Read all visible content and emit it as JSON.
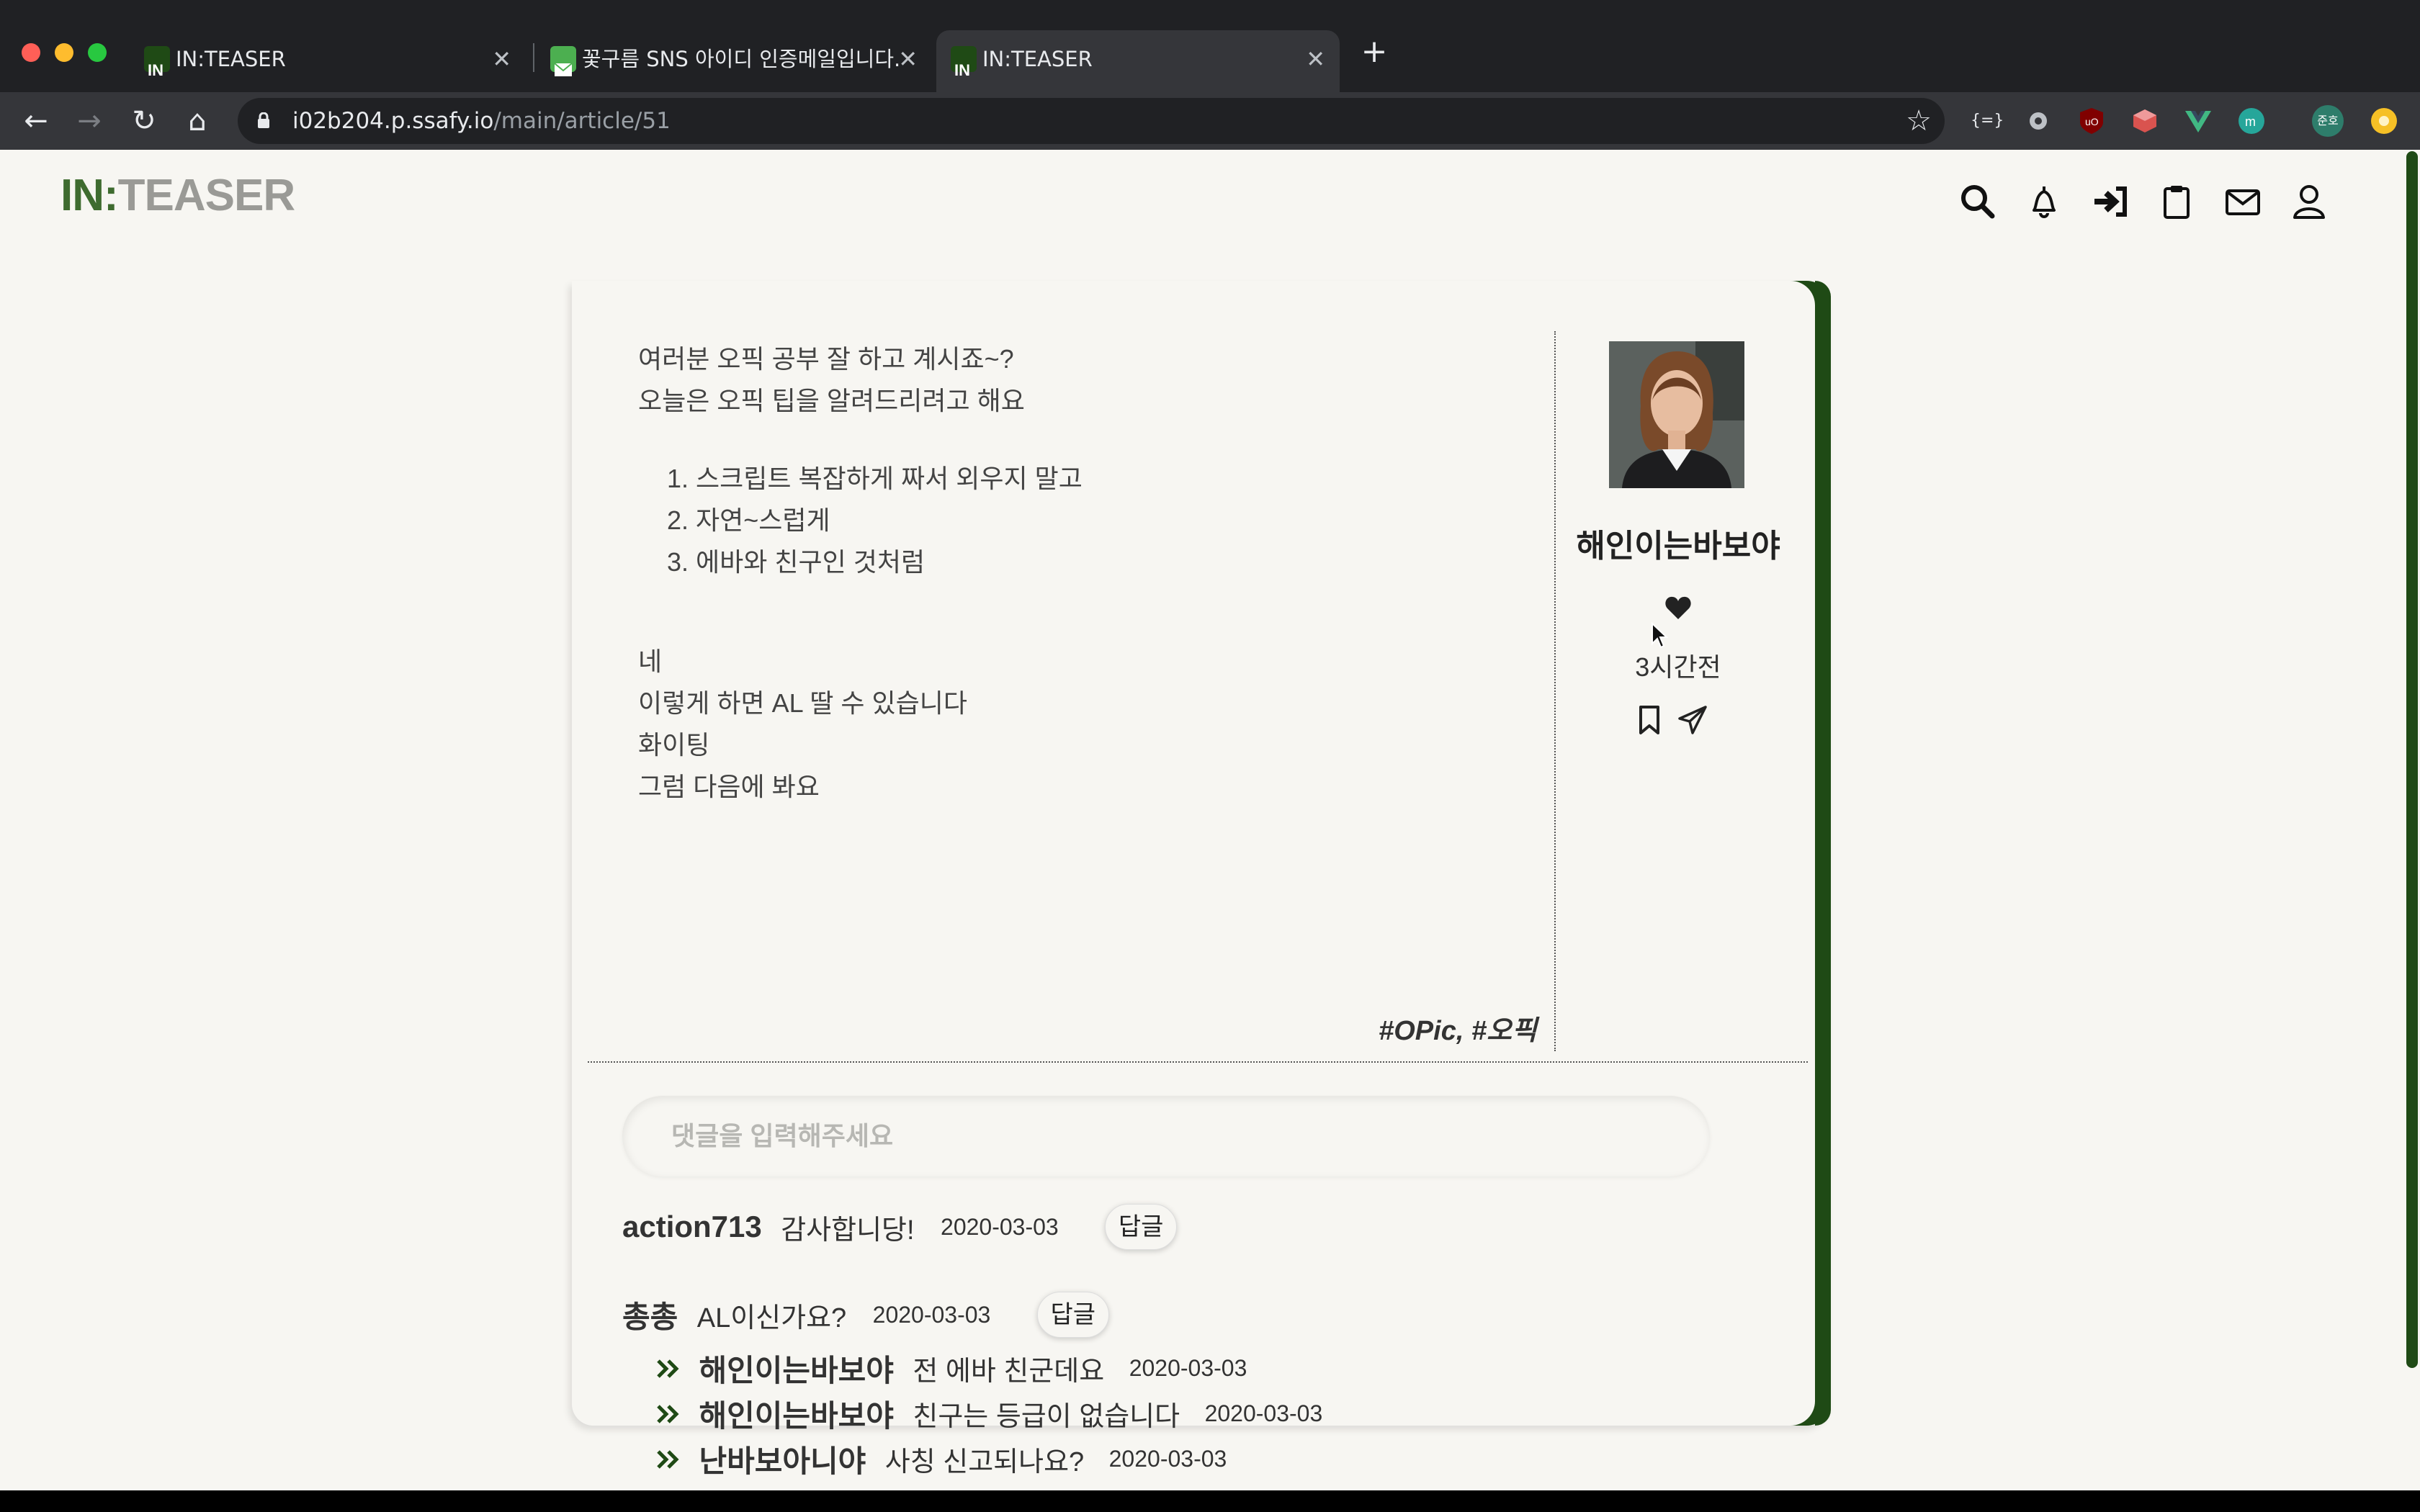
{
  "browser": {
    "tabs": [
      {
        "title": "IN:TEASER",
        "active": false,
        "favicon": "inteaser-favicon"
      },
      {
        "title": "꽃구름 SNS 아이디 인증메일입니다.",
        "active": false,
        "favicon": "mail-favicon"
      },
      {
        "title": "IN:TEASER",
        "active": true,
        "favicon": "inteaser-favicon"
      }
    ],
    "close_glyph": "✕",
    "new_tab_glyph": "+",
    "url_host": "i02b204.p.ssafy.io",
    "url_path": "/main/article/51",
    "profile_initials": "준호",
    "nav": {
      "back": "←",
      "forward": "→",
      "reload": "↻",
      "home": "⌂",
      "star": "☆"
    }
  },
  "site": {
    "logo_in": "IN",
    "logo_colon": ":",
    "logo_teaser": "TEASER",
    "accent_color": "#1f4a15",
    "nav_icons": [
      "search-icon",
      "bell-icon",
      "login-icon",
      "clipboard-icon",
      "mail-icon",
      "user-icon"
    ]
  },
  "post": {
    "lines_intro": [
      "여러분 오픽 공부 잘 하고 계시죠~?",
      "오늘은 오픽 팁을 알려드리려고 해요"
    ],
    "list": [
      "1. 스크립트 복잡하게 짜서 외우지 말고",
      "2. 자연~스럽게",
      "3. 에바와 친구인 것처럼"
    ],
    "lines_outro": [
      "네",
      "이렇게 하면 AL 딸 수 있습니다",
      "화이팅",
      "그럼 다음에 봐요"
    ],
    "tags": "#OPic, #오픽",
    "author": "해인이는바보야",
    "time": "3시간전"
  },
  "comments": {
    "placeholder": "댓글을 입력해주세요",
    "reply_label": "답글",
    "items": [
      {
        "author": "action713",
        "text": "감사합니당!",
        "date": "2020-03-03"
      },
      {
        "author": "총총",
        "text": "AL이신가요?",
        "date": "2020-03-03",
        "replies": [
          {
            "author": "해인이는바보야",
            "text": "전 에바 친군데요",
            "date": "2020-03-03"
          },
          {
            "author": "해인이는바보야",
            "text": "친구는 등급이 없습니다",
            "date": "2020-03-03"
          },
          {
            "author": "난바보아니야",
            "text": "사칭 신고되나요?",
            "date": "2020-03-03"
          }
        ]
      }
    ]
  }
}
